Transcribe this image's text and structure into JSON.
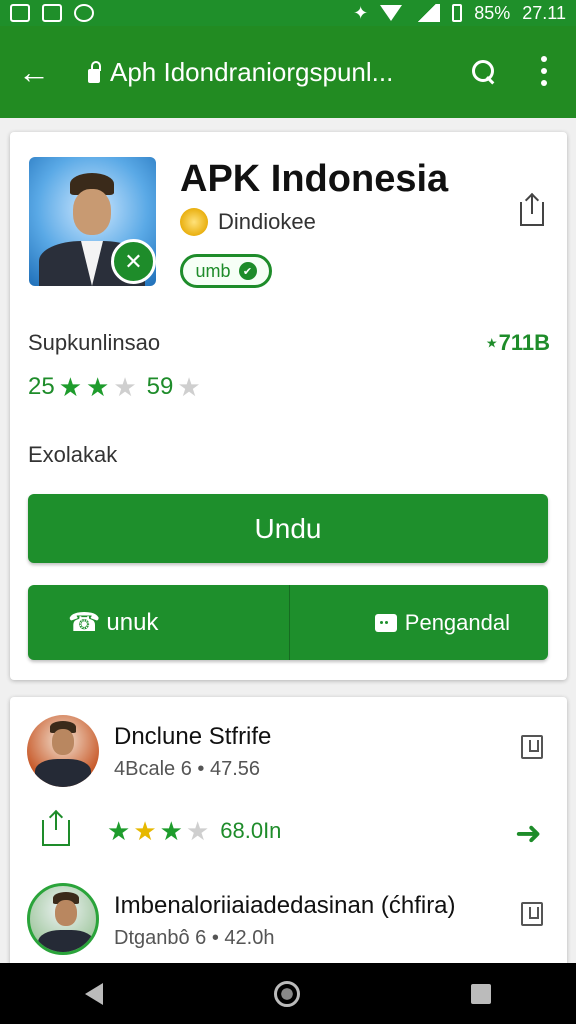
{
  "status_bar": {
    "battery": "85%",
    "time": "27.11",
    "left_icons": [
      "image-icon",
      "gallery-icon",
      "download-icon"
    ],
    "right_icons": [
      "vibrate-icon",
      "wifi-icon",
      "signal-icon",
      "battery-icon"
    ]
  },
  "app_bar": {
    "url": "Aph Idondraniorgspunl...",
    "icons": [
      "back-arrow-icon",
      "lock-icon",
      "search-icon",
      "more-vert-icon"
    ],
    "color": "#228b22"
  },
  "app_card": {
    "title": "APK Indonesia",
    "developer": "Dindiokee",
    "chip_label": "umb",
    "info_label": "Supkunlinsao",
    "size_value": "⋆711B",
    "rating": {
      "left_value": "25",
      "stars": [
        1,
        1,
        0.5
      ],
      "right_value": "59",
      "right_stars": [
        0
      ]
    },
    "category": "Exolakak",
    "primary_button": "Undu",
    "left_button": "unuk",
    "right_button": "Pengandal",
    "accent_color": "#1e8f2c"
  },
  "list_items": [
    {
      "title": "Dnclune Stfrife",
      "subtitle": "4Bcale 6 • 47.56",
      "stars": [
        1,
        0.8,
        1,
        0
      ],
      "count": "68.0In"
    },
    {
      "title": "Imbenaloriiaiadedasinan (ćhfira)",
      "subtitle": "Dtganbô 6 • 42.0h"
    }
  ],
  "nav_bar": {
    "icons": [
      "nav-back-icon",
      "nav-home-icon",
      "nav-recents-icon"
    ]
  }
}
